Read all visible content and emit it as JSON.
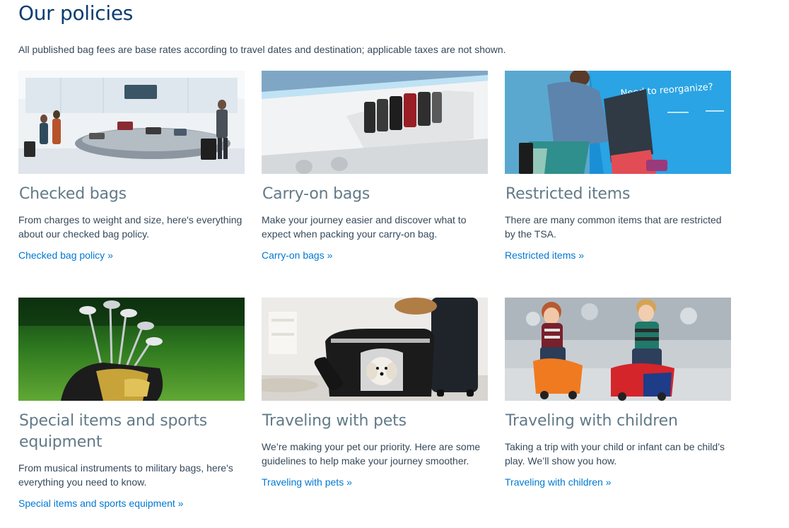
{
  "page": {
    "title": "Our policies",
    "intro": "All published bag fees are base rates according to travel dates and destination; applicable taxes are not shown."
  },
  "colors": {
    "title": "#0b3c71",
    "card_title": "#627a88",
    "body_text": "#36495a",
    "link": "#0078d2"
  },
  "cards": [
    {
      "image_name": "checked-bags-image",
      "title": "Checked bags",
      "desc_line1": "From charges to weight and size, here's everything",
      "desc_line2": "about our checked bag policy.",
      "link": "Checked bag policy »"
    },
    {
      "image_name": "carry-on-bags-image",
      "title": "Carry-on bags",
      "desc_line1": "Make your journey easier and discover what to",
      "desc_line2": "expect when packing your carry-on bag.",
      "link": "Carry-on bags »"
    },
    {
      "image_name": "restricted-items-image",
      "title": "Restricted items",
      "image_text": "Need to reorganize?",
      "desc_line1": "There are many common items that are restricted",
      "desc_line2": "by the TSA.",
      "link": "Restricted items »"
    },
    {
      "image_name": "sports-equipment-image",
      "title_line1": "Special items and sports",
      "title_line2": "equipment",
      "desc_line1": "From musical instruments to military bags, here's",
      "desc_line2": "everything you need to know.",
      "link": "Special items and sports equipment »"
    },
    {
      "image_name": "pets-image",
      "title": "Traveling with pets",
      "desc_line1": "We’re making your pet our priority. Here are some",
      "desc_line2": "guidelines to help make your journey smoother.",
      "link": "Traveling with pets »"
    },
    {
      "image_name": "children-image",
      "title": "Traveling with children",
      "desc_line1": "Taking a trip with your child or infant can be child’s",
      "desc_line2": "play. We’ll show you how.",
      "link": "Traveling with children »"
    }
  ]
}
